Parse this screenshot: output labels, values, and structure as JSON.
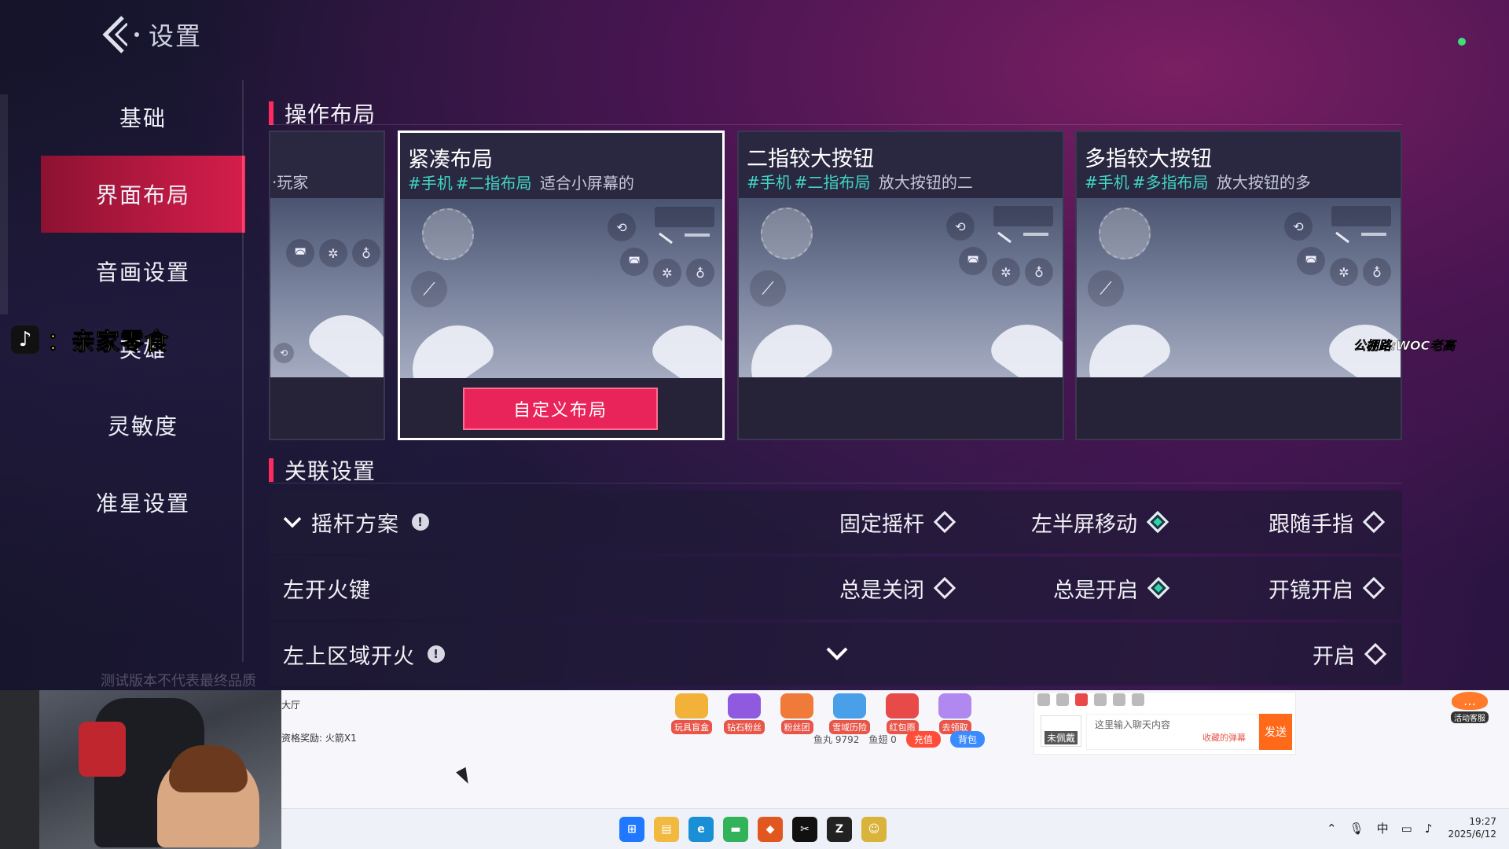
{
  "header": {
    "title": "设置"
  },
  "sidebar": {
    "items": [
      {
        "label": "基础",
        "active": false
      },
      {
        "label": "界面布局",
        "active": true
      },
      {
        "label": "音画设置",
        "active": false
      },
      {
        "label": "英雄",
        "active": false
      },
      {
        "label": "灵敏度",
        "active": false
      },
      {
        "label": "准星设置",
        "active": false
      }
    ]
  },
  "version_note": "测试版本不代表最终品质",
  "layout_section": {
    "title": "操作布局",
    "partial_card_tag": "·玩家",
    "cards": [
      {
        "title": "紧凑布局",
        "tags": [
          "#手机",
          "#二指布局"
        ],
        "desc": "适合小屏幕的",
        "selected": true
      },
      {
        "title": "二指较大按钮",
        "tags": [
          "#手机",
          "#二指布局"
        ],
        "desc": "放大按钮的二",
        "selected": false
      },
      {
        "title": "多指较大按钮",
        "tags": [
          "#手机",
          "#多指布局"
        ],
        "desc": "放大按钮的多",
        "selected": false
      }
    ],
    "custom_button": "自定义布局"
  },
  "related_section": {
    "title": "关联设置",
    "rows": [
      {
        "label": "摇杆方案",
        "has_info": true,
        "expanded": true,
        "options": [
          {
            "label": "固定摇杆",
            "checked": false
          },
          {
            "label": "左半屏移动",
            "checked": true
          },
          {
            "label": "跟随手指",
            "checked": false
          }
        ]
      },
      {
        "label": "左开火键",
        "has_info": false,
        "options": [
          {
            "label": "总是关闭",
            "checked": false
          },
          {
            "label": "总是开启",
            "checked": true
          },
          {
            "label": "开镜开启",
            "checked": false
          }
        ]
      },
      {
        "label": "左上区域开火",
        "has_info": true,
        "options": [
          {
            "label": "开启",
            "checked": false
          }
        ]
      }
    ]
  },
  "overlay": {
    "tiktok_text": "：亲家零食",
    "woc_text": "公棚路:WOC老高"
  },
  "browser": {
    "lobby": "大厅",
    "reward": "资格奖励: 火箭X1",
    "icons": [
      {
        "label": "玩具盲盒",
        "color": "#f2b23a"
      },
      {
        "label": "钻石粉丝",
        "color": "#8f5ae0"
      },
      {
        "label": "粉丝团",
        "color": "#f07a3a"
      },
      {
        "label": "雪域历险",
        "color": "#4aa0e8"
      },
      {
        "label": "红包雨",
        "color": "#e84a4a"
      },
      {
        "label": "去领取",
        "color": "#b088f0"
      }
    ],
    "fish_ball": "鱼丸 9792",
    "fish_wing": "鱼翅 0",
    "recharge": "充值",
    "backpack": "背包",
    "chat_badge": "未佩戴",
    "chat_placeholder": "这里输入聊天内容",
    "chat_sub": "收藏的弹幕",
    "send": "发送",
    "service": "活动客服"
  },
  "taskbar": {
    "ime": "中",
    "time": "19:27",
    "date": "2025/6/12",
    "apps": [
      {
        "name": "start",
        "color": "#1f78ff",
        "glyph": "⊞"
      },
      {
        "name": "explorer",
        "color": "#f2b940",
        "glyph": "▤"
      },
      {
        "name": "edge",
        "color": "#1a8fd6",
        "glyph": "e"
      },
      {
        "name": "app-green",
        "color": "#32b35a",
        "glyph": "▬"
      },
      {
        "name": "app-orange",
        "color": "#e2571f",
        "glyph": "◆"
      },
      {
        "name": "app-capcut",
        "color": "#111111",
        "glyph": "✂"
      },
      {
        "name": "app-z",
        "color": "#222222",
        "glyph": "Z"
      },
      {
        "name": "app-face",
        "color": "#d9b33a",
        "glyph": "☺"
      }
    ]
  }
}
